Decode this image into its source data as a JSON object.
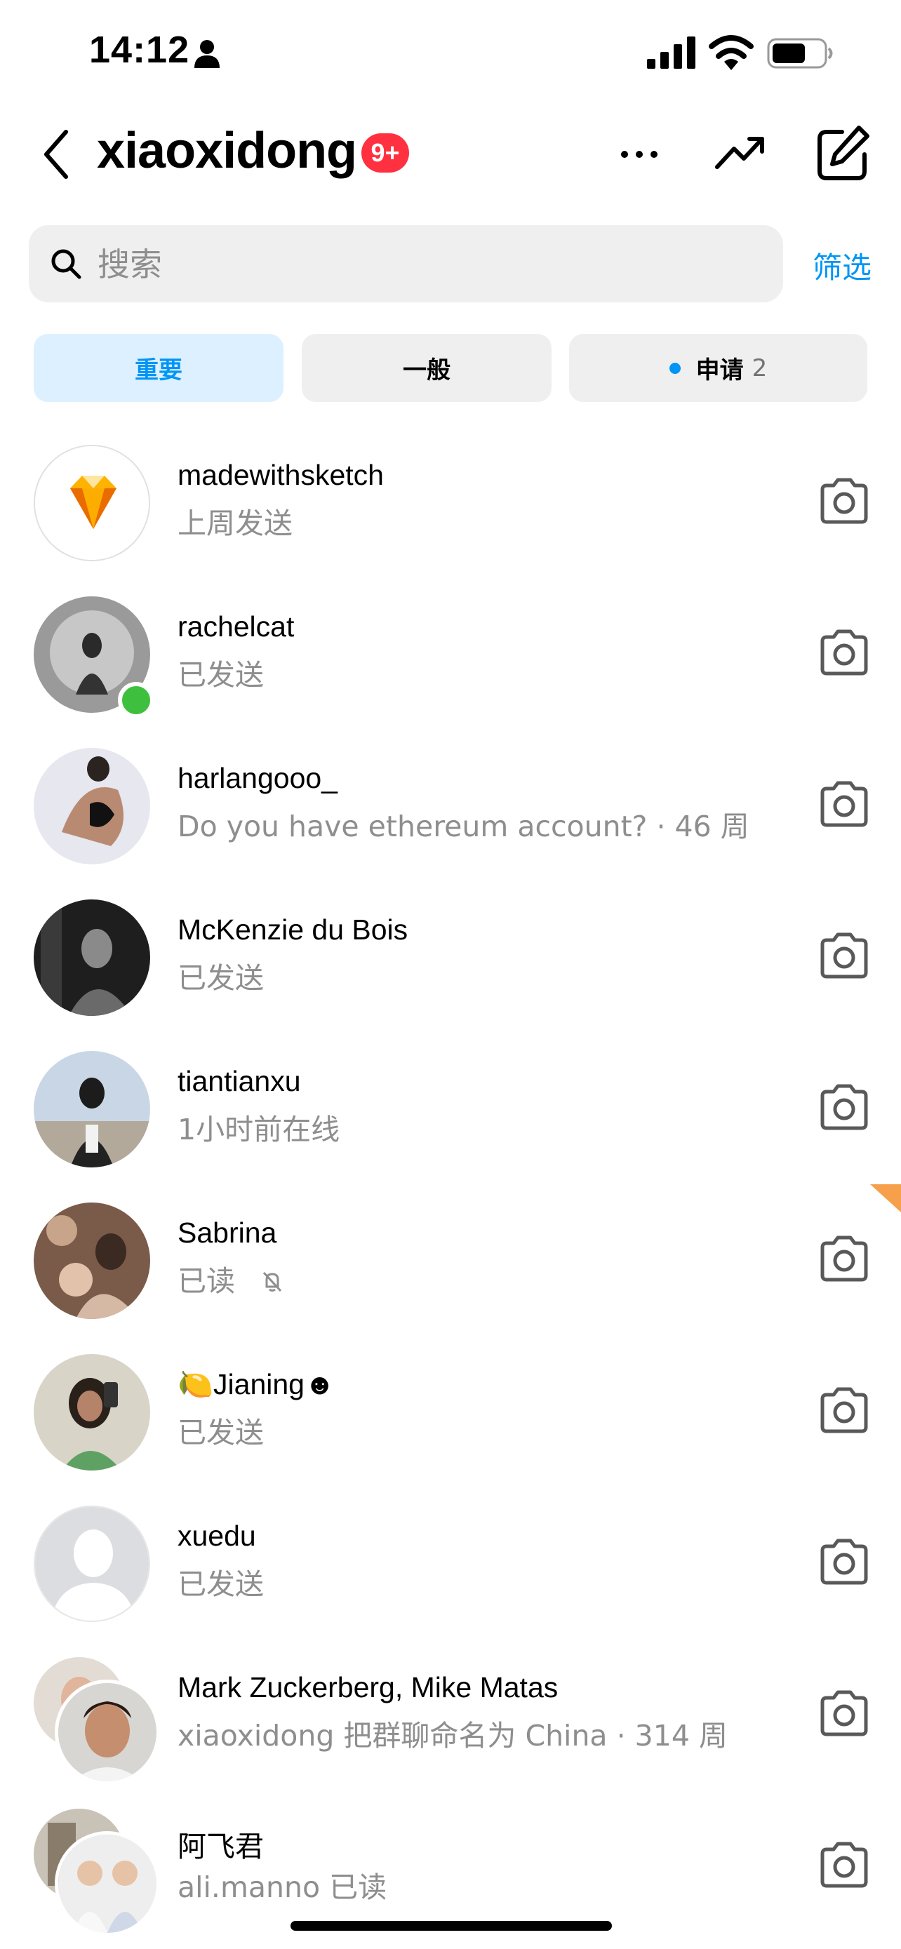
{
  "status_bar": {
    "time": "14:12"
  },
  "header": {
    "title": "xiaoxidong",
    "badge": "9+"
  },
  "search": {
    "placeholder": "搜索",
    "filter_label": "筛选"
  },
  "tabs": {
    "primary": "重要",
    "general": "一般",
    "requests": "申请",
    "requests_count": "2"
  },
  "conversations": [
    {
      "name": "madewithsketch",
      "subtitle": "上周发送"
    },
    {
      "name": "rachelcat",
      "subtitle": "已发送",
      "online": true
    },
    {
      "name": "harlangooo_",
      "subtitle": "Do you have ethereum account? · 46 周"
    },
    {
      "name": "McKenzie du Bois",
      "subtitle": "已发送"
    },
    {
      "name": "tiantianxu",
      "subtitle": "1小时前在线"
    },
    {
      "name": "Sabrina",
      "subtitle": "已读",
      "muted": true
    },
    {
      "name": "🍋Jianing☻",
      "subtitle": "已发送"
    },
    {
      "name": "xuedu",
      "subtitle": "已发送"
    },
    {
      "name": "Mark Zuckerberg, Mike Matas",
      "subtitle": "xiaoxidong 把群聊命名为 China · 314 周"
    },
    {
      "name": "阿飞君",
      "subtitle": "ali.manno 已读"
    }
  ],
  "colors": {
    "accent": "#0095f6",
    "badge": "#ff3040",
    "online": "#3ec03e"
  }
}
